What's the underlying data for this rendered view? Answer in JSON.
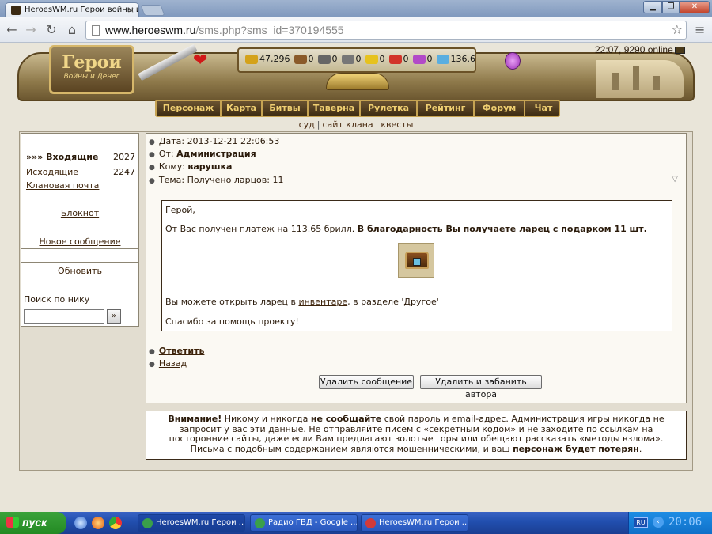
{
  "browser": {
    "tab_title": "HeroesWM.ru Герои войны и денег",
    "url_host": "www.heroeswm.ru",
    "url_path": "/sms.php?sms_id=370194555"
  },
  "game": {
    "logo_title": "Герои",
    "logo_subtitle": "Войны и Денег",
    "online_text": "22:07, 9290 online",
    "resources": [
      {
        "name": "gold",
        "value": "47,296",
        "color": "#d4a21a"
      },
      {
        "name": "wood",
        "value": "0",
        "color": "#8a5a2a"
      },
      {
        "name": "ore",
        "value": "0",
        "color": "#666666"
      },
      {
        "name": "mercury",
        "value": "0",
        "color": "#777777"
      },
      {
        "name": "sulfur",
        "value": "0",
        "color": "#e6c21e"
      },
      {
        "name": "crystals",
        "value": "0",
        "color": "#d2342a"
      },
      {
        "name": "gems",
        "value": "0",
        "color": "#b24ac8"
      },
      {
        "name": "diamonds",
        "value": "136.6",
        "color": "#5aaee0"
      }
    ],
    "nav": [
      "Персонаж",
      "Карта",
      "Битвы",
      "Таверна",
      "Рулетка",
      "Рейтинг",
      "Форум",
      "Чат"
    ],
    "sublinks": [
      "суд",
      "сайт клана",
      "квесты"
    ]
  },
  "sidebar": {
    "inbox_label": "»»» Входящие",
    "inbox_count": "2027",
    "outbox_label": "Исходящие",
    "outbox_count": "2247",
    "clan_mail": "Клановая почта",
    "notepad": "Блокнот",
    "new_message": "Новое сообщение",
    "refresh": "Обновить",
    "search_label": "Поиск по нику",
    "search_button": "»"
  },
  "message": {
    "date_label": "Дата:",
    "date_value": "2013-12-21 22:06:53",
    "from_label": "От:",
    "from_value": "Администрация",
    "to_label": "Кому:",
    "to_value": "варушка",
    "subject_label": "Тема:",
    "subject_value": "Получено ларцов: 11",
    "greeting": "Герой,",
    "line1_plain": "От Вас получен платеж на 113.65 брилл.",
    "line1_bold": "В благодарность Вы получаете ларец с подарком 11 шт.",
    "line2_before": "Вы можете открыть ларец в",
    "line2_link": "инвентаре",
    "line2_after": ", в разделе 'Другое'",
    "thanks": "Спасибо за помощь проекту!",
    "reply": "Ответить",
    "back": "Назад",
    "delete_button": "Удалить сообщение",
    "delete_ban_button": "Удалить и забанить автора"
  },
  "warning": {
    "attention": "Внимание!",
    "t1": "Никому и никогда",
    "t2": "не сообщайте",
    "t3": "свой пароль и email-адрес. Администрация игры никогда не запросит у вас эти данные. Не отправляйте писем с «секретным кодом» и не заходите по ссылкам на посторонние сайты, даже если Вам предлагают золотые горы или обещают рассказать «методы взлома». Письма с подобным содержанием являются мошенническими, и ваш",
    "t4": "персонаж будет потерян",
    "t5": "."
  },
  "taskbar": {
    "start": "пуск",
    "tasks": [
      {
        "label": "HeroesWM.ru Герои ...",
        "color": "#3aa04a"
      },
      {
        "label": "Радио ГВД - Google ...",
        "color": "#3aa04a"
      },
      {
        "label": "HeroesWM.ru Герои ...",
        "color": "#d23a3a"
      }
    ],
    "lang": "RU",
    "clock": "20:06"
  }
}
